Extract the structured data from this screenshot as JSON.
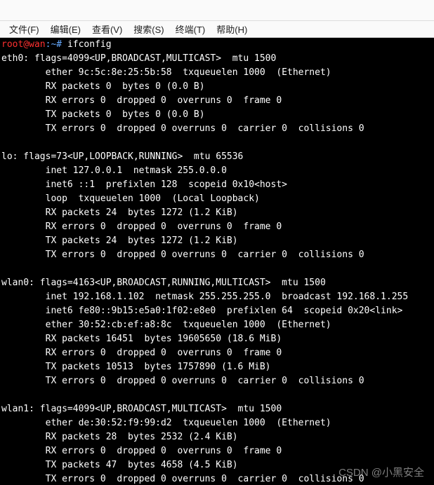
{
  "menu": {
    "file": "文件(F)",
    "edit": "编辑(E)",
    "view": "查看(V)",
    "search": "搜索(S)",
    "terminal": "终端(T)",
    "help": "帮助(H)"
  },
  "prompt": {
    "user": "root@wan",
    "path": ":~# ",
    "command": "ifconfig"
  },
  "output": {
    "eth0": {
      "l1": "eth0: flags=4099<UP,BROADCAST,MULTICAST>  mtu 1500",
      "l2": "        ether 9c:5c:8e:25:5b:58  txqueuelen 1000  (Ethernet)",
      "l3": "        RX packets 0  bytes 0 (0.0 B)",
      "l4": "        RX errors 0  dropped 0  overruns 0  frame 0",
      "l5": "        TX packets 0  bytes 0 (0.0 B)",
      "l6": "        TX errors 0  dropped 0 overruns 0  carrier 0  collisions 0"
    },
    "lo": {
      "l1": "lo: flags=73<UP,LOOPBACK,RUNNING>  mtu 65536",
      "l2": "        inet 127.0.0.1  netmask 255.0.0.0",
      "l3": "        inet6 ::1  prefixlen 128  scopeid 0x10<host>",
      "l4": "        loop  txqueuelen 1000  (Local Loopback)",
      "l5": "        RX packets 24  bytes 1272 (1.2 KiB)",
      "l6": "        RX errors 0  dropped 0  overruns 0  frame 0",
      "l7": "        TX packets 24  bytes 1272 (1.2 KiB)",
      "l8": "        TX errors 0  dropped 0 overruns 0  carrier 0  collisions 0"
    },
    "wlan0": {
      "l1": "wlan0: flags=4163<UP,BROADCAST,RUNNING,MULTICAST>  mtu 1500",
      "l2": "        inet 192.168.1.102  netmask 255.255.255.0  broadcast 192.168.1.255",
      "l3": "        inet6 fe80::9b15:e5a0:1f02:e8e0  prefixlen 64  scopeid 0x20<link>",
      "l4": "        ether 30:52:cb:ef:a8:8c  txqueuelen 1000  (Ethernet)",
      "l5": "        RX packets 16451  bytes 19605650 (18.6 MiB)",
      "l6": "        RX errors 0  dropped 0  overruns 0  frame 0",
      "l7": "        TX packets 10513  bytes 1757890 (1.6 MiB)",
      "l8": "        TX errors 0  dropped 0 overruns 0  carrier 0  collisions 0"
    },
    "wlan1": {
      "l1": "wlan1: flags=4099<UP,BROADCAST,MULTICAST>  mtu 1500",
      "l2": "        ether de:30:52:f9:99:d2  txqueuelen 1000  (Ethernet)",
      "l3": "        RX packets 28  bytes 2532 (2.4 KiB)",
      "l4": "        RX errors 0  dropped 0  overruns 0  frame 0",
      "l5": "        TX packets 47  bytes 4658 (4.5 KiB)",
      "l6": "        TX errors 0  dropped 0 overruns 0  carrier 0  collisions 0"
    }
  },
  "watermark": "CSDN @小黑安全"
}
